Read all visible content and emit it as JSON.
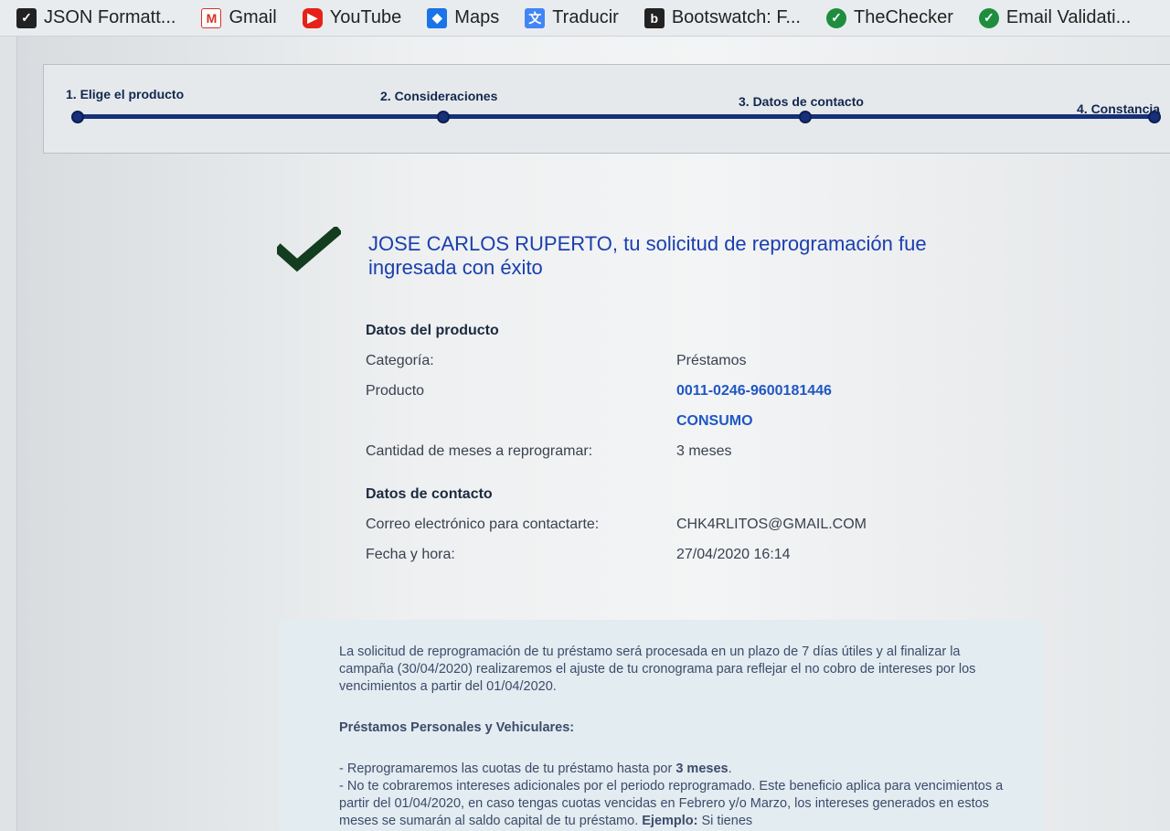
{
  "bookmarks": [
    {
      "label": "JSON Formatt...",
      "icon": "check-square-icon",
      "color": "#222222"
    },
    {
      "label": "Gmail",
      "icon": "gmail-icon",
      "color": "#d93025"
    },
    {
      "label": "YouTube",
      "icon": "youtube-icon",
      "color": "#e62117"
    },
    {
      "label": "Maps",
      "icon": "maps-icon",
      "color": "#1a73e8"
    },
    {
      "label": "Traducir",
      "icon": "translate-icon",
      "color": "#4285f4"
    },
    {
      "label": "Bootswatch: F...",
      "icon": "bootswatch-icon",
      "color": "#222222"
    },
    {
      "label": "TheChecker",
      "icon": "checker-icon",
      "color": "#1e8e3e"
    },
    {
      "label": "Email Validati...",
      "icon": "email-validation-icon",
      "color": "#1e8e3e"
    }
  ],
  "stepper": {
    "steps": [
      {
        "label": "1. Elige el producto"
      },
      {
        "label": "2. Consideraciones"
      },
      {
        "label": "3. Datos de contacto"
      },
      {
        "label": "4. Constancia"
      }
    ],
    "accent": "#16307a"
  },
  "success": {
    "title": "JOSE CARLOS RUPERTO, tu solicitud de reprogramación fue ingresada con éxito",
    "icon": "checkmark-icon"
  },
  "product": {
    "section_title": "Datos del producto",
    "category_label": "Categoría:",
    "category_value": "Préstamos",
    "product_label": "Producto",
    "product_number": "0011-0246-9600181446",
    "product_type": "CONSUMO",
    "months_label": "Cantidad de meses a reprogramar:",
    "months_value": "3 meses"
  },
  "contact": {
    "section_title": "Datos de contacto",
    "email_label": "Correo electrónico para contactarte:",
    "email_value": "CHK4RLITOS@GMAIL.COM",
    "datetime_label": "Fecha y hora:",
    "datetime_value": "27/04/2020 16:14"
  },
  "info": {
    "paragraph": "La solicitud de reprogramación de tu préstamo será procesada en un plazo de 7 días útiles y al finalizar la campaña (30/04/2020) realizaremos el ajuste de tu cronograma para reflejar el no cobro de intereses por los vencimientos a partir del 01/04/2020.",
    "subtitle": "Préstamos Personales y Vehiculares:",
    "bullet1_prefix": "- Reprogramaremos las cuotas de tu préstamo hasta por ",
    "bullet1_bold": "3 meses",
    "bullet1_suffix": ".",
    "bullet2_prefix": "- No te cobraremos intereses adicionales por el periodo reprogramado. Este beneficio aplica para vencimientos a partir del 01/04/2020, en caso tengas cuotas vencidas en Febrero y/o Marzo, los intereses generados en estos meses se sumarán al saldo capital de tu préstamo. ",
    "bullet2_bold": "Ejemplo:",
    "bullet2_suffix": " Si tienes"
  },
  "colors": {
    "title_blue": "#1a3fae",
    "link_blue": "#1f57c3",
    "check_green": "#123d1e"
  }
}
